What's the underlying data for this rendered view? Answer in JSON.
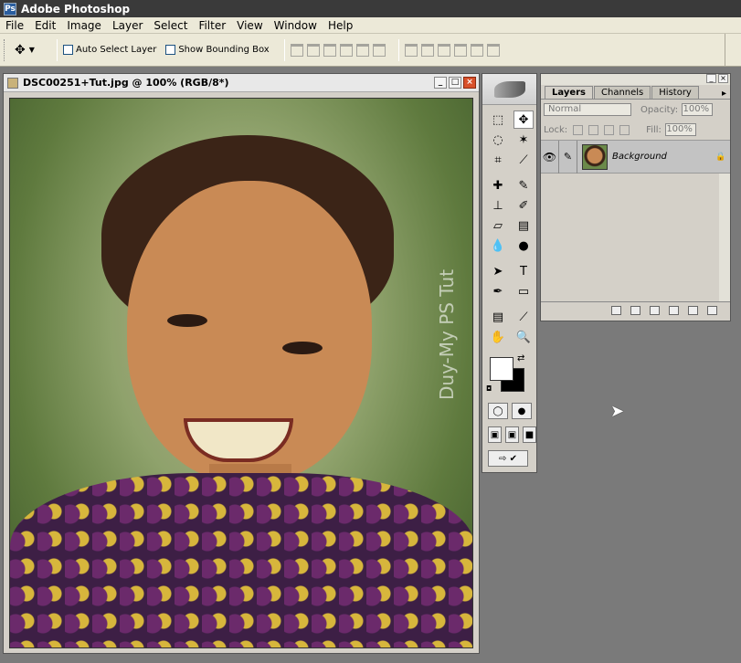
{
  "app": {
    "title": "Adobe Photoshop"
  },
  "menu": [
    "File",
    "Edit",
    "Image",
    "Layer",
    "Select",
    "Filter",
    "View",
    "Window",
    "Help"
  ],
  "options": {
    "auto_select_layer": "Auto Select Layer",
    "show_bounding_box": "Show Bounding Box"
  },
  "document": {
    "title": "DSC00251+Tut.jpg @ 100% (RGB/8*)",
    "watermark": "Duy-My PS Tut"
  },
  "layers_panel": {
    "tabs": [
      "Layers",
      "Channels",
      "History"
    ],
    "blend_mode": "Normal",
    "opacity_label": "Opacity:",
    "opacity_value": "100%",
    "lock_label": "Lock:",
    "fill_label": "Fill:",
    "fill_value": "100%",
    "layers": [
      {
        "name": "Background"
      }
    ]
  },
  "colors": {
    "foreground": "#ffffff",
    "background": "#000000",
    "title_bar": "#3a3a3a"
  }
}
